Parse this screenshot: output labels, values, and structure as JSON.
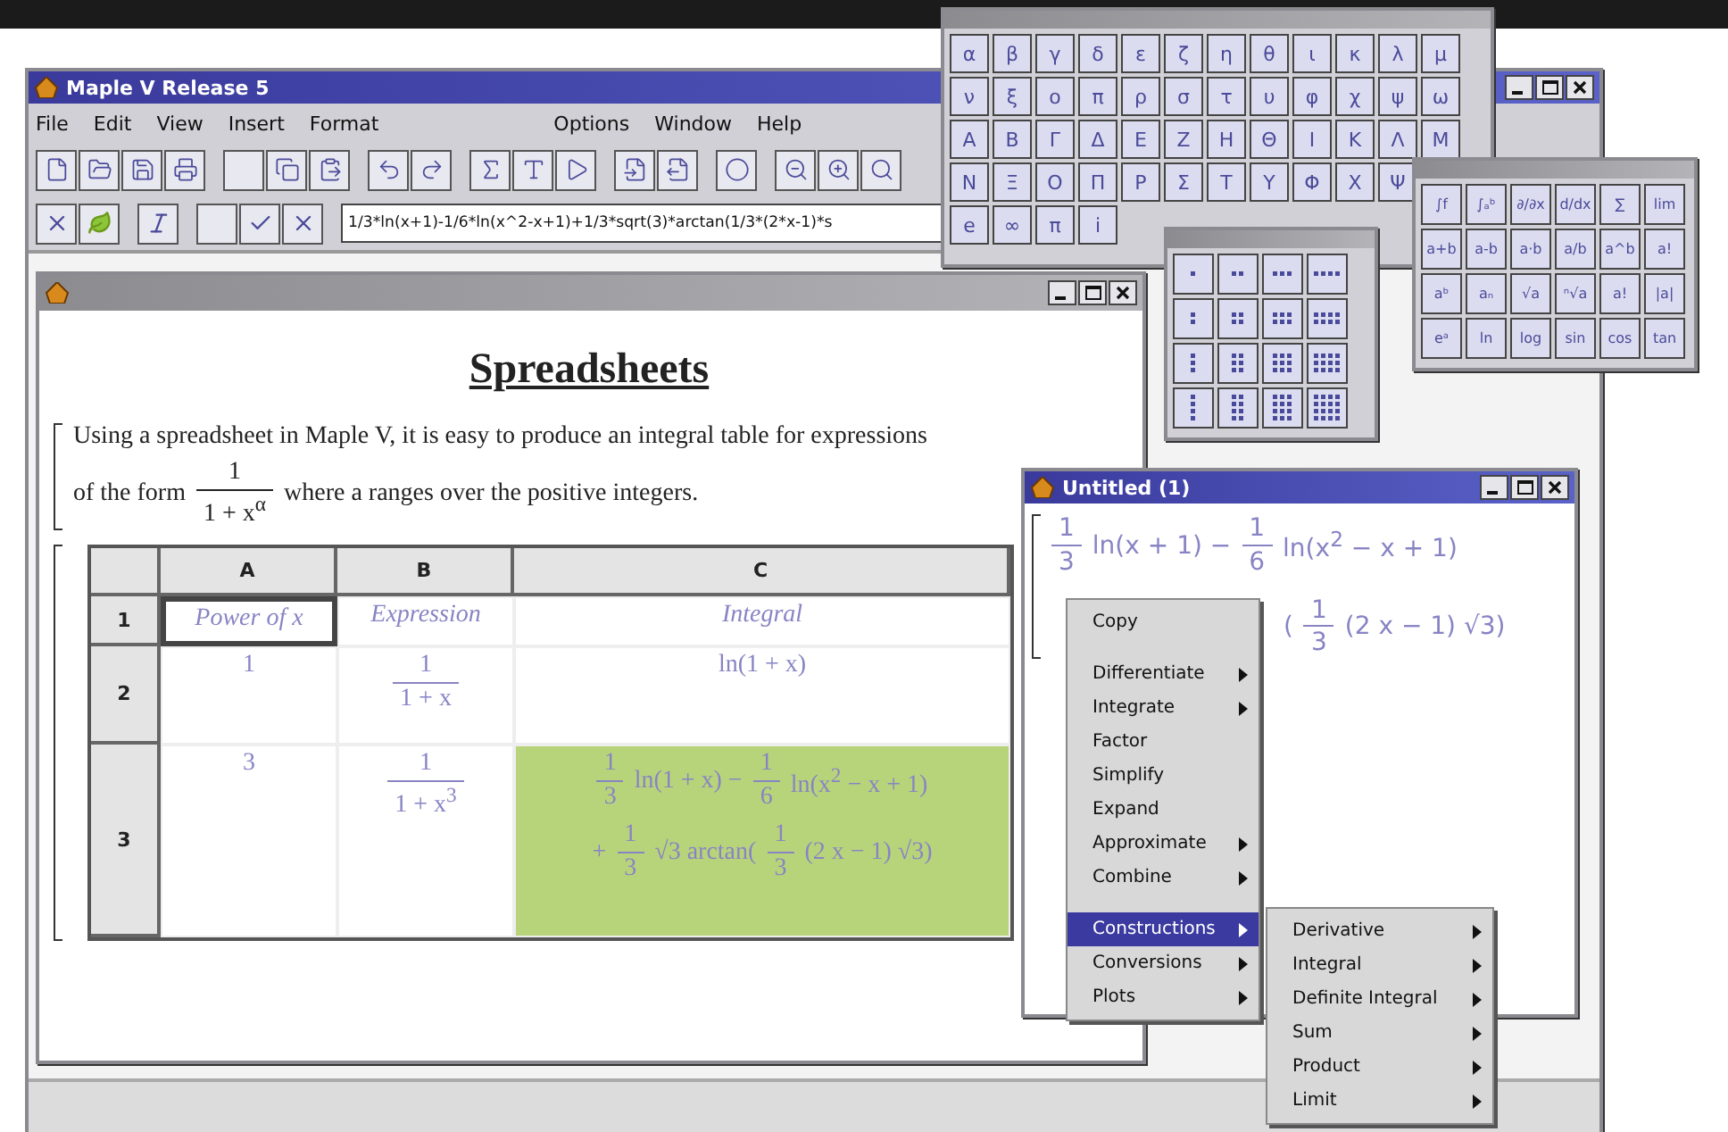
{
  "main_window": {
    "title": "Maple V Release 5",
    "active": true
  },
  "menu_bar": {
    "left": [
      "File",
      "Edit",
      "View",
      "Insert",
      "Format"
    ],
    "right": [
      "Options",
      "Window",
      "Help"
    ]
  },
  "input_field": {
    "value": "1/3*ln(x+1)-1/6*ln(x^2-x+1)+1/3*sqrt(3)*arctan(1/3*(2*x-1)*s"
  },
  "document_window": {
    "active": false,
    "heading": "Spreadsheets",
    "paragraph": [
      [
        {
          "kind": "text",
          "text": "Using a spreadsheet in Maple V, it is easy to produce an integral table for expressions"
        }
      ],
      [
        {
          "kind": "text",
          "text": "of the form"
        },
        {
          "kind": "frac",
          "num": "1",
          "den": "1 + x$^{α}$"
        },
        {
          "kind": "text",
          "text": "where a ranges over the positive integers."
        }
      ]
    ],
    "spreadsheet": {
      "columns": [
        "A",
        "B",
        "C"
      ],
      "row_labels": [
        "1",
        "2",
        "3"
      ],
      "rows": [
        [
          {
            "selected": true,
            "highlighted": false,
            "lines": [
              [
                {
                  "kind": "text",
                  "text": "Power of x",
                  "italic": true
                }
              ]
            ]
          },
          {
            "selected": false,
            "highlighted": false,
            "lines": [
              [
                {
                  "kind": "text",
                  "text": "Expression",
                  "italic": true
                }
              ]
            ]
          },
          {
            "selected": false,
            "highlighted": false,
            "lines": [
              [
                {
                  "kind": "text",
                  "text": "Integral",
                  "italic": true
                }
              ]
            ]
          }
        ],
        [
          {
            "selected": false,
            "highlighted": false,
            "lines": [
              [
                {
                  "kind": "text",
                  "text": "1"
                }
              ]
            ]
          },
          {
            "selected": false,
            "highlighted": false,
            "lines": [
              [
                {
                  "kind": "frac",
                  "num": "1",
                  "den": "1 + x"
                }
              ]
            ]
          },
          {
            "selected": false,
            "highlighted": false,
            "lines": [
              [
                {
                  "kind": "text",
                  "text": "ln(1 + x)"
                }
              ]
            ]
          }
        ],
        [
          {
            "selected": false,
            "highlighted": false,
            "lines": [
              [
                {
                  "kind": "text",
                  "text": "3"
                }
              ]
            ]
          },
          {
            "selected": false,
            "highlighted": false,
            "lines": [
              [
                {
                  "kind": "frac",
                  "num": "1",
                  "den": "1 + x$^{3}$"
                }
              ]
            ]
          },
          {
            "selected": false,
            "highlighted": true,
            "lines": [
              [
                {
                  "kind": "frac",
                  "num": "1",
                  "den": "3"
                },
                {
                  "kind": "text",
                  "text": "ln(1 + x) −"
                },
                {
                  "kind": "frac",
                  "num": "1",
                  "den": "6"
                },
                {
                  "kind": "text",
                  "text": "ln(x$^{2}$ − x + 1)"
                }
              ],
              [
                {
                  "kind": "text",
                  "text": "+"
                },
                {
                  "kind": "frac",
                  "num": "1",
                  "den": "3"
                },
                {
                  "kind": "text",
                  "text": "√3 arctan("
                },
                {
                  "kind": "frac",
                  "num": "1",
                  "den": "3"
                },
                {
                  "kind": "text",
                  "text": "(2 x − 1) √3)"
                }
              ]
            ]
          }
        ]
      ]
    }
  },
  "symbol_palette": {
    "active": false,
    "symbols": [
      [
        "α",
        "β",
        "γ",
        "δ",
        "ε",
        "ζ",
        "η",
        "θ",
        "ι",
        "κ",
        "λ",
        "μ"
      ],
      [
        "ν",
        "ξ",
        "ο",
        "π",
        "ρ",
        "σ",
        "τ",
        "υ",
        "φ",
        "χ",
        "ψ",
        "ω"
      ],
      [
        "Α",
        "Β",
        "Γ",
        "Δ",
        "Ε",
        "Ζ",
        "Η",
        "Θ",
        "Ι",
        "Κ",
        "Λ",
        "Μ"
      ],
      [
        "Ν",
        "Ξ",
        "Ο",
        "Π",
        "Ρ",
        "Σ",
        "Τ",
        "Υ",
        "Φ",
        "Χ",
        "Ψ"
      ],
      [
        "e",
        "∞",
        "π",
        "i"
      ]
    ]
  },
  "matrix_palette": {
    "active": false
  },
  "expression_palette": {
    "active": false,
    "templates": [
      [
        "∫f",
        "∫ₐᵇ",
        "∂/∂x",
        "d/dx",
        "∑",
        "lim"
      ],
      [
        "a+b",
        "a-b",
        "a·b",
        "a/b",
        "a^b",
        "a!"
      ],
      [
        "aᵇ",
        "aₙ",
        "√a",
        "ⁿ√a",
        "a!",
        "|a|"
      ],
      [
        "eᵃ",
        "ln",
        "log",
        "sin",
        "cos",
        "tan"
      ]
    ]
  },
  "untitled_window": {
    "title": "Untitled (1)",
    "active": true,
    "output": [
      [
        {
          "kind": "frac",
          "num": "1",
          "den": "3"
        },
        {
          "kind": "text",
          "text": "ln(x + 1) −"
        },
        {
          "kind": "frac",
          "num": "1",
          "den": "6"
        },
        {
          "kind": "text",
          "text": "ln(x$^{2}$ − x + 1)"
        }
      ],
      [
        {
          "kind": "text",
          "text": "("
        },
        {
          "kind": "frac",
          "num": "1",
          "den": "3"
        },
        {
          "kind": "text",
          "text": "(2 x − 1) √3)"
        }
      ]
    ]
  },
  "context_menu": [
    {
      "kind": "item",
      "label": "Copy",
      "submenu": false,
      "selected": false
    },
    {
      "kind": "separator"
    },
    {
      "kind": "item",
      "label": "Differentiate",
      "submenu": true,
      "selected": false
    },
    {
      "kind": "item",
      "label": "Integrate",
      "submenu": true,
      "selected": false
    },
    {
      "kind": "item",
      "label": "Factor",
      "submenu": false,
      "selected": false
    },
    {
      "kind": "item",
      "label": "Simplify",
      "submenu": false,
      "selected": false
    },
    {
      "kind": "item",
      "label": "Expand",
      "submenu": false,
      "selected": false
    },
    {
      "kind": "item",
      "label": "Approximate",
      "submenu": true,
      "selected": false
    },
    {
      "kind": "item",
      "label": "Combine",
      "submenu": true,
      "selected": false
    },
    {
      "kind": "separator"
    },
    {
      "kind": "item",
      "label": "Constructions",
      "submenu": true,
      "selected": true
    },
    {
      "kind": "item",
      "label": "Conversions",
      "submenu": true,
      "selected": false
    },
    {
      "kind": "item",
      "label": "Plots",
      "submenu": true,
      "selected": false
    }
  ],
  "submenu": [
    {
      "kind": "item",
      "label": "Derivative",
      "submenu": true,
      "selected": false
    },
    {
      "kind": "item",
      "label": "Integral",
      "submenu": true,
      "selected": false
    },
    {
      "kind": "item",
      "label": "Definite Integral",
      "submenu": true,
      "selected": false
    },
    {
      "kind": "item",
      "label": "Sum",
      "submenu": true,
      "selected": false
    },
    {
      "kind": "item",
      "label": "Product",
      "submenu": true,
      "selected": false
    },
    {
      "kind": "item",
      "label": "Limit",
      "submenu": true,
      "selected": false
    }
  ]
}
